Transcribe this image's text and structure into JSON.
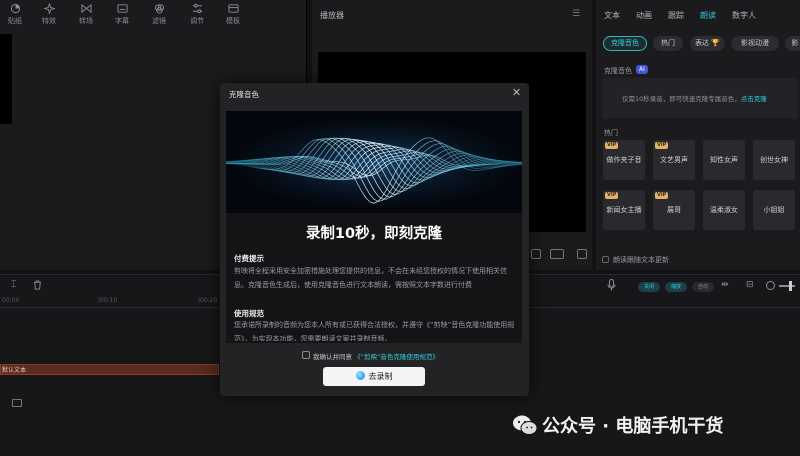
{
  "toolbar": {
    "items": [
      {
        "label": "贴纸",
        "icon": "sticker-icon"
      },
      {
        "label": "特效",
        "icon": "sparkle-icon"
      },
      {
        "label": "转场",
        "icon": "transition-icon"
      },
      {
        "label": "字幕",
        "icon": "caption-icon"
      },
      {
        "label": "滤镜",
        "icon": "filter-icon"
      },
      {
        "label": "调节",
        "icon": "adjust-icon"
      },
      {
        "label": "模板",
        "icon": "template-icon"
      }
    ]
  },
  "player": {
    "title": "播放器"
  },
  "right_panel": {
    "tabs": [
      {
        "label": "文本",
        "active": false
      },
      {
        "label": "动画",
        "active": false
      },
      {
        "label": "跟踪",
        "active": false
      },
      {
        "label": "朗读",
        "active": true
      },
      {
        "label": "数字人",
        "active": false
      }
    ],
    "chips": [
      {
        "label": "克隆音色",
        "active": true
      },
      {
        "label": "热门",
        "active": false
      },
      {
        "label": "表达 🏆",
        "active": false
      },
      {
        "label": "影视动漫",
        "active": false
      },
      {
        "label": "影",
        "active": false
      }
    ],
    "clone_label": "克隆音色",
    "ai_badge": "AI",
    "clone_hint": "仅需10秒录音，即可快速克隆专属音色，",
    "clone_link": "点击克隆",
    "hot_label": "热门",
    "vip_tag": "VIP",
    "voices": [
      {
        "name": "做作夹子音",
        "vip": true
      },
      {
        "name": "文艺男声",
        "vip": true
      },
      {
        "name": "知性女声",
        "vip": false
      },
      {
        "name": "创世女神",
        "vip": false
      },
      {
        "name": "新闻女主播",
        "vip": true
      },
      {
        "name": "展哥",
        "vip": true
      },
      {
        "name": "温柔淑女",
        "vip": false
      },
      {
        "name": "小姐姐",
        "vip": false
      }
    ],
    "read_follow_label": "朗读跟随文本更新"
  },
  "timeline": {
    "ticks": [
      "00:00",
      "|00:10",
      "|00:20"
    ],
    "track_label": "默认文本",
    "pills": [
      "关闭",
      "缩放",
      "自动"
    ]
  },
  "modal": {
    "title": "克隆音色",
    "headline": "录制10秒，即刻克隆",
    "section1_title": "付费提示",
    "section1_body": "剪映将全程采用安全加密措施处理您提供的信息，不会在未经您授权的情况下使用相关信息。克隆音色生成后，使用克隆音色进行文本朗读，需按照文本字数进行付费",
    "section2_title": "使用规范",
    "section2_body": "您承诺所录制的音频为您本人所有或已获得合法授权，并遵守《“剪映”音色克隆功能使用规范》，为实现本功能，您需要朗读文案并录制音频。",
    "agree_prefix": "我确认并同意",
    "agree_link": "《“剪映”音色克隆使用规范》",
    "record_button": "去录制"
  },
  "watermark": {
    "text": "公众号 · 电脑手机干货"
  }
}
